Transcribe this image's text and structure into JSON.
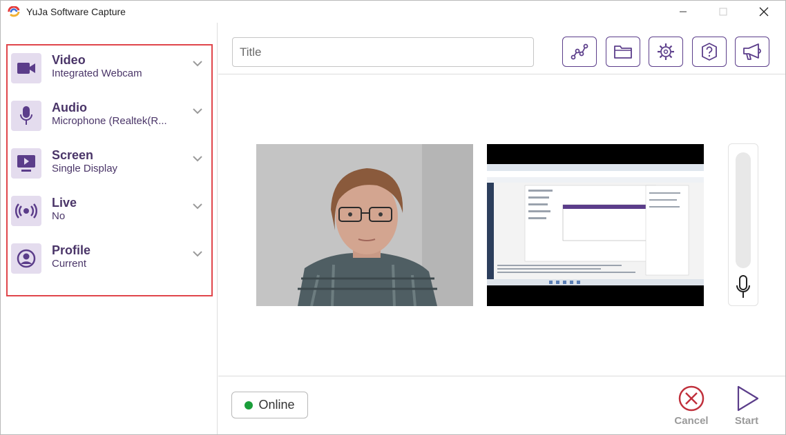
{
  "window": {
    "title": "YuJa Software Capture",
    "colors": {
      "accent": "#5b3d8a",
      "highlight": "#e0454a",
      "cancel": "#c0303c",
      "online": "#1a9e3a",
      "icon_bg": "#e4dcee"
    }
  },
  "sidebar": {
    "items": [
      {
        "label": "Video",
        "value": "Integrated Webcam",
        "icon": "video-camera-icon"
      },
      {
        "label": "Audio",
        "value": "Microphone (Realtek(R...",
        "icon": "microphone-icon"
      },
      {
        "label": "Screen",
        "value": "Single Display",
        "icon": "monitor-play-icon"
      },
      {
        "label": "Live",
        "value": "No",
        "icon": "broadcast-icon"
      },
      {
        "label": "Profile",
        "value": "Current",
        "icon": "user-circle-icon"
      }
    ]
  },
  "topbar": {
    "title_placeholder": "Title",
    "tools": [
      "graph-icon",
      "folder-icon",
      "settings-icon",
      "help-icon",
      "megaphone-icon"
    ]
  },
  "bottombar": {
    "status_label": "Online",
    "cancel_label": "Cancel",
    "start_label": "Start"
  }
}
